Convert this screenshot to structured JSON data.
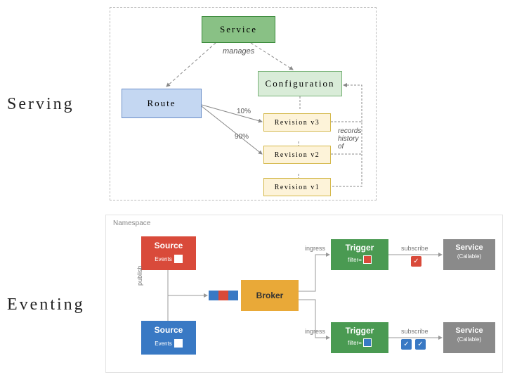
{
  "sections": {
    "serving_label": "Serving",
    "eventing_label": "Eventing"
  },
  "serving": {
    "service": "Service",
    "route": "Route",
    "configuration": "Configuration",
    "revisions": [
      "Revision v3",
      "Revision v2",
      "Revision v1"
    ],
    "manages_label": "manages",
    "traffic_split": {
      "pct10": "10%",
      "pct90": "90%"
    },
    "records_label": "records\nhistory\nof"
  },
  "eventing": {
    "namespace_label": "Namespace",
    "source_label": "Source",
    "events_label": "Events",
    "broker_label": "Broker",
    "trigger_label": "Trigger",
    "filter_label": "filter=",
    "service_label": "Service",
    "callable_label": "(Callable)",
    "publish_label": "publish",
    "ingress_label": "ingress",
    "subscribe_label": "subscribe",
    "check_glyph": "✓"
  }
}
